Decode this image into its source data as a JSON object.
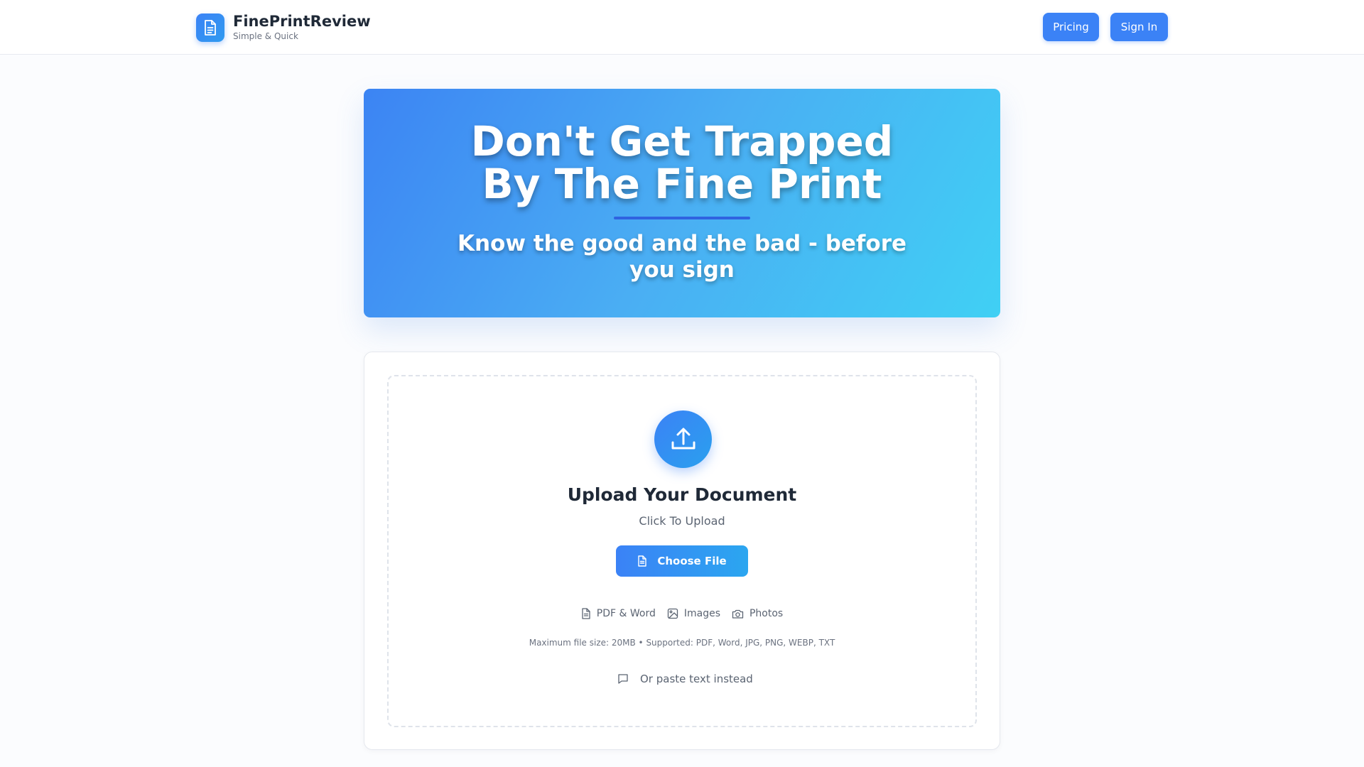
{
  "brand": {
    "name": "FinePrintReview",
    "tagline": "Simple & Quick"
  },
  "nav": {
    "pricing_label": "Pricing",
    "signin_label": "Sign In"
  },
  "hero": {
    "title_line1": "Don't Get Trapped",
    "title_line2": "By The Fine Print",
    "subtitle_line1": "Know the good and the bad - before",
    "subtitle_line2": "you sign"
  },
  "upload": {
    "title": "Upload Your Document",
    "subtitle": "Click To Upload",
    "choose_label": "Choose File",
    "formats": [
      {
        "icon": "document-icon",
        "label": "PDF & Word"
      },
      {
        "icon": "image-icon",
        "label": "Images"
      },
      {
        "icon": "camera-icon",
        "label": "Photos"
      }
    ],
    "limits": "Maximum file size: 20MB • Supported: PDF, Word, JPG, PNG, WEBP, TXT",
    "paste_label": "Or paste text instead"
  },
  "colors": {
    "accent": "#3b82f6",
    "hero_gradient_start": "#3c84f3",
    "hero_gradient_end": "#40d0f4"
  }
}
